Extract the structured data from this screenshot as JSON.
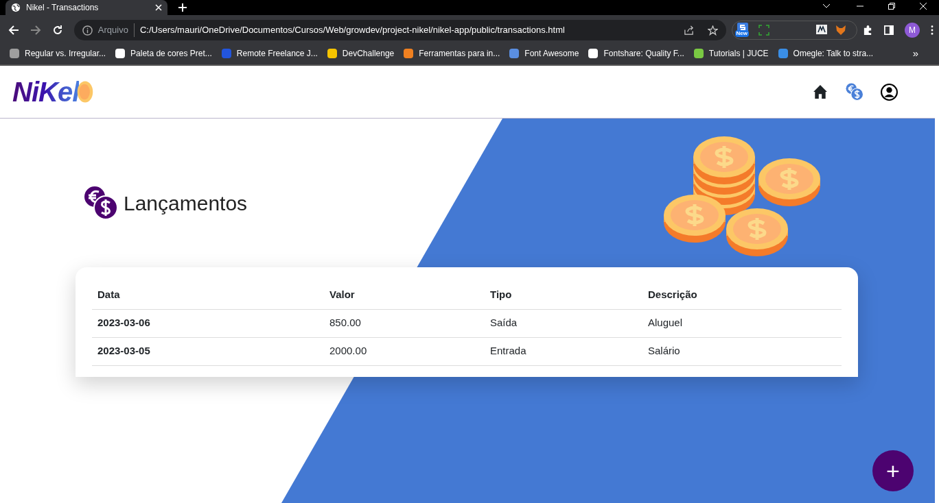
{
  "browser": {
    "tab_title": "Nikel - Transactions",
    "security_label": "Arquivo",
    "url": "C:/Users/mauri/OneDrive/Documentos/Cursos/Web/growdev/project-nikel/nikel-app/public/transactions.html",
    "extension_badge": "New",
    "profile_initial": "M",
    "more_bookmarks": "»",
    "bookmarks": [
      {
        "label": "Regular vs. Irregular...",
        "color": "#9e9e9e"
      },
      {
        "label": "Paleta de cores Pret...",
        "color": "#ffffff"
      },
      {
        "label": "Remote Freelance J...",
        "color": "#2255dd"
      },
      {
        "label": "DevChallenge",
        "color": "#f5c400"
      },
      {
        "label": "Ferramentas para in...",
        "color": "#f08020"
      },
      {
        "label": "Font Awesome",
        "color": "#5a8ee0"
      },
      {
        "label": "Fontshare: Quality F...",
        "color": "#ffffff"
      },
      {
        "label": "Tutorials | JUCE",
        "color": "#7ac943"
      },
      {
        "label": "Omegle: Talk to stra...",
        "color": "#3a8ee6"
      }
    ]
  },
  "header": {
    "logo": "NiKel"
  },
  "page_title": "Lançamentos",
  "table": {
    "columns": [
      "Data",
      "Valor",
      "Tipo",
      "Descrição"
    ],
    "rows": [
      [
        "2023-03-06",
        "850.00",
        "Saída",
        "Aluguel"
      ],
      [
        "2023-03-05",
        "2000.00",
        "Entrada",
        "Salário"
      ]
    ]
  },
  "fab": "+"
}
